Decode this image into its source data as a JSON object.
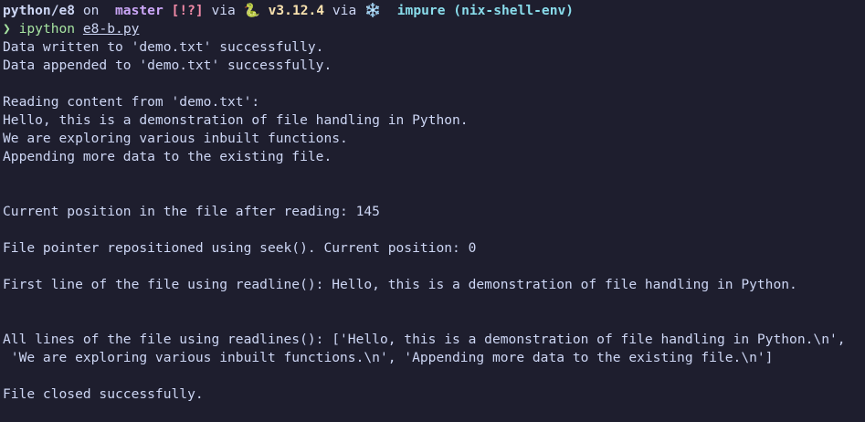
{
  "prompt": {
    "path": "python/e8",
    "on_text": " on ",
    "branch_icon": "",
    "branch": " master",
    "status": " [!?]",
    "via1": " via ",
    "python_icon": "🐍",
    "python_version": " v3.12.4",
    "via2": " via ",
    "nix_icon": "❄️",
    "nix_env": "  impure (nix-shell-env)"
  },
  "command": {
    "caret": "❯",
    "program": " ipython",
    "argument": "e8-b.py"
  },
  "output": [
    "Data written to 'demo.txt' successfully.",
    "Data appended to 'demo.txt' successfully.",
    "",
    "Reading content from 'demo.txt':",
    "Hello, this is a demonstration of file handling in Python.",
    "We are exploring various inbuilt functions.",
    "Appending more data to the existing file.",
    "",
    "",
    "Current position in the file after reading: 145",
    "",
    "File pointer repositioned using seek(). Current position: 0",
    "",
    "First line of the file using readline(): Hello, this is a demonstration of file handling in Python.",
    "",
    "",
    "All lines of the file using readlines(): ['Hello, this is a demonstration of file handling in Python.\\n',",
    " 'We are exploring various inbuilt functions.\\n', 'Appending more data to the existing file.\\n']",
    "",
    "File closed successfully."
  ],
  "colors": {
    "background": "#1e1e2e",
    "foreground": "#cdd6f4",
    "branch": "#cba6f7",
    "status": "#f38ba8",
    "python": "#f9e2af",
    "nix": "#89dceb",
    "command": "#a6e3a1"
  }
}
